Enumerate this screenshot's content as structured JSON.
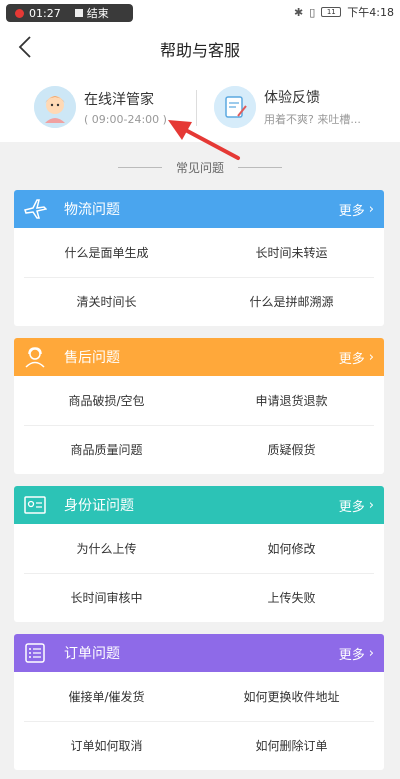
{
  "statusbar": {
    "recording_time": "01:27",
    "recording_end": "结束",
    "time": "下午4:18",
    "battery": "11"
  },
  "header": {
    "title": "帮助与客服"
  },
  "service": {
    "online": {
      "name": "在线洋管家",
      "hours": "( 09:00-24:00 )"
    },
    "feedback": {
      "name": "体验反馈",
      "sub": "用着不爽? 来吐槽..."
    }
  },
  "faq": {
    "title": "常见问题"
  },
  "sections": [
    {
      "title": "物流问题",
      "more": "更多",
      "color": "#4aa5ee",
      "icon": "airplane-icon",
      "questions": [
        "什么是面单生成",
        "长时间未转运",
        "清关时间长",
        "什么是拼邮溯源"
      ]
    },
    {
      "title": "售后问题",
      "more": "更多",
      "color": "#ffa83a",
      "icon": "customer-service-icon",
      "questions": [
        "商品破损/空包",
        "申请退货退款",
        "商品质量问题",
        "质疑假货"
      ]
    },
    {
      "title": "身份证问题",
      "more": "更多",
      "color": "#2cc3b6",
      "icon": "id-card-icon",
      "questions": [
        "为什么上传",
        "如何修改",
        "长时间审核中",
        "上传失败"
      ]
    },
    {
      "title": "订单问题",
      "more": "更多",
      "color": "#8e6ae8",
      "icon": "order-list-icon",
      "questions": [
        "催接单/催发货",
        "如何更换收件地址",
        "订单如何取消",
        "如何删除订单"
      ]
    }
  ]
}
